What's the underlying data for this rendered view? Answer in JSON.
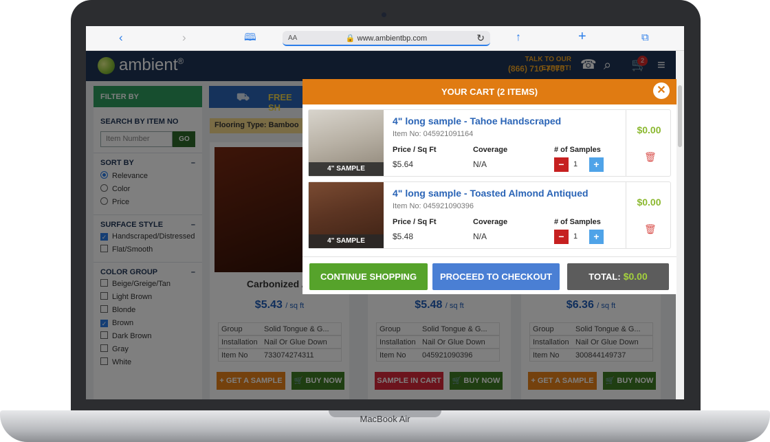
{
  "device": {
    "label": "MacBook Air"
  },
  "browser": {
    "aa": "AA",
    "url": "www.ambientbp.com"
  },
  "header": {
    "logo": "ambient",
    "logo_mark": "®",
    "talk_label": "TALK TO OUR EXPERT!",
    "phone": "(866) 710-7070",
    "cart_count": "2"
  },
  "sidebar": {
    "filter_by": "FILTER BY",
    "search_title": "SEARCH BY ITEM NO",
    "search_placeholder": "Item Number",
    "go": "GO",
    "sort_title": "SORT BY",
    "sort_options": [
      "Relevance",
      "Color",
      "Price"
    ],
    "surface_title": "SURFACE STYLE",
    "surface_options": [
      "Handscraped/Distressed",
      "Flat/Smooth"
    ],
    "color_title": "COLOR GROUP",
    "color_options": [
      "Beige/Greige/Tan",
      "Light Brown",
      "Blonde",
      "Brown",
      "Dark Brown",
      "Gray",
      "White"
    ]
  },
  "banner": {
    "free_ship": "FREE SH"
  },
  "chip": "Flooring Type: Bamboo",
  "products": [
    {
      "name": "Carbonized Ar",
      "price": "$5.43",
      "unit": "/ sq ft",
      "group_label": "Group",
      "group": "Solid Tongue & G...",
      "install_label": "Installation",
      "install": "Nail Or Glue Down",
      "item_label": "Item No",
      "item": "733074274311",
      "left_btn": "+ GET A SAMPLE",
      "buy": "BUY NOW"
    },
    {
      "name": "",
      "price": "$5.48",
      "unit": "/ sq ft",
      "group_label": "Group",
      "group": "Solid Tongue & G...",
      "install_label": "Installation",
      "install": "Nail Or Glue Down",
      "item_label": "Item No",
      "item": "045921090396",
      "left_btn": "SAMPLE IN CART",
      "buy": "BUY NOW"
    },
    {
      "name": "",
      "price": "$6.36",
      "unit": "/ sq ft",
      "group_label": "Group",
      "group": "Solid Tongue & G...",
      "install_label": "Installation",
      "install": "Nail Or Glue Down",
      "item_label": "Item No",
      "item": "300844149737",
      "left_btn": "+ GET A SAMPLE",
      "buy": "BUY NOW"
    }
  ],
  "cart": {
    "title": "YOUR CART (2 ITEMS)",
    "close": "✕",
    "items": [
      {
        "title": "4\" long sample - Tahoe Handscraped",
        "item_no": "Item No: 045921091164",
        "thumb_label": "4\" SAMPLE",
        "price_label": "Price / Sq Ft",
        "price": "$5.64",
        "coverage_label": "Coverage",
        "coverage": "N/A",
        "samples_label": "# of Samples",
        "qty": "1",
        "total": "$0.00"
      },
      {
        "title": "4\" long sample - Toasted Almond Antiqued",
        "item_no": "Item No: 045921090396",
        "thumb_label": "4\" SAMPLE",
        "price_label": "Price / Sq Ft",
        "price": "$5.48",
        "coverage_label": "Coverage",
        "coverage": "N/A",
        "samples_label": "# of Samples",
        "qty": "1",
        "total": "$0.00"
      }
    ],
    "continue": "CONTINUE SHOPPING",
    "checkout": "PROCEED TO CHECKOUT",
    "total_label": "TOTAL:",
    "total_value": "$0.00"
  },
  "colors": {
    "header": "#1f3556",
    "cart_head": "#e07b12",
    "continue": "#56a32b",
    "checkout": "#4a7fd4",
    "price_green": "#8bb82f"
  }
}
